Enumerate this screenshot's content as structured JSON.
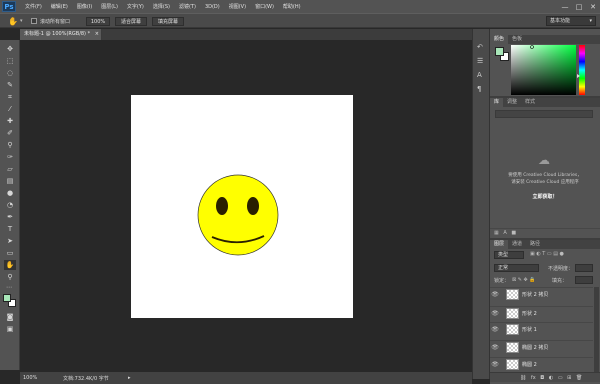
{
  "app": {
    "logo": "Ps"
  },
  "menubar": {
    "items": [
      "文件(F)",
      "编辑(E)",
      "图像(I)",
      "图层(L)",
      "文字(Y)",
      "选择(S)",
      "滤镜(T)",
      "3D(D)",
      "视图(V)",
      "窗口(W)",
      "帮助(H)"
    ],
    "window_controls": [
      "—",
      "□",
      "✕"
    ]
  },
  "options_bar": {
    "scroll_all_windows": "滚动所有窗口",
    "zoom_100": "100%",
    "fit_screen": "适合屏幕",
    "fill_screen": "填充屏幕",
    "workspace": "基本功能"
  },
  "document": {
    "tab_title": "未标题-1 @ 100%(RGB/8) *",
    "zoom": "100%",
    "doc_info": "文档:732.4K/0 字节"
  },
  "panels": {
    "color_tabs": [
      "颜色",
      "色板"
    ],
    "adjust_tabs": [
      "库",
      "调整",
      "样式"
    ],
    "cc_message_line1": "要使用 Creative Cloud Libraries，",
    "cc_message_line2": "请安装 Creative Cloud 应用程序",
    "cc_link": "立即获取！",
    "layers_tabs": [
      "图层",
      "通道",
      "路径"
    ],
    "filter_kind": "类型",
    "blend_mode": "正常",
    "opacity_label": "不透明度：",
    "lock_label": "锁定：",
    "fill_label": "填充：",
    "layers": [
      "形状 2 拷贝",
      "形状 2",
      "形状 1",
      "椭圆 2 拷贝",
      "椭圆 2"
    ]
  },
  "colors": {
    "smiley_fill": "#ffff00",
    "foreground": "#a8e6b8",
    "background": "#ffffff"
  }
}
